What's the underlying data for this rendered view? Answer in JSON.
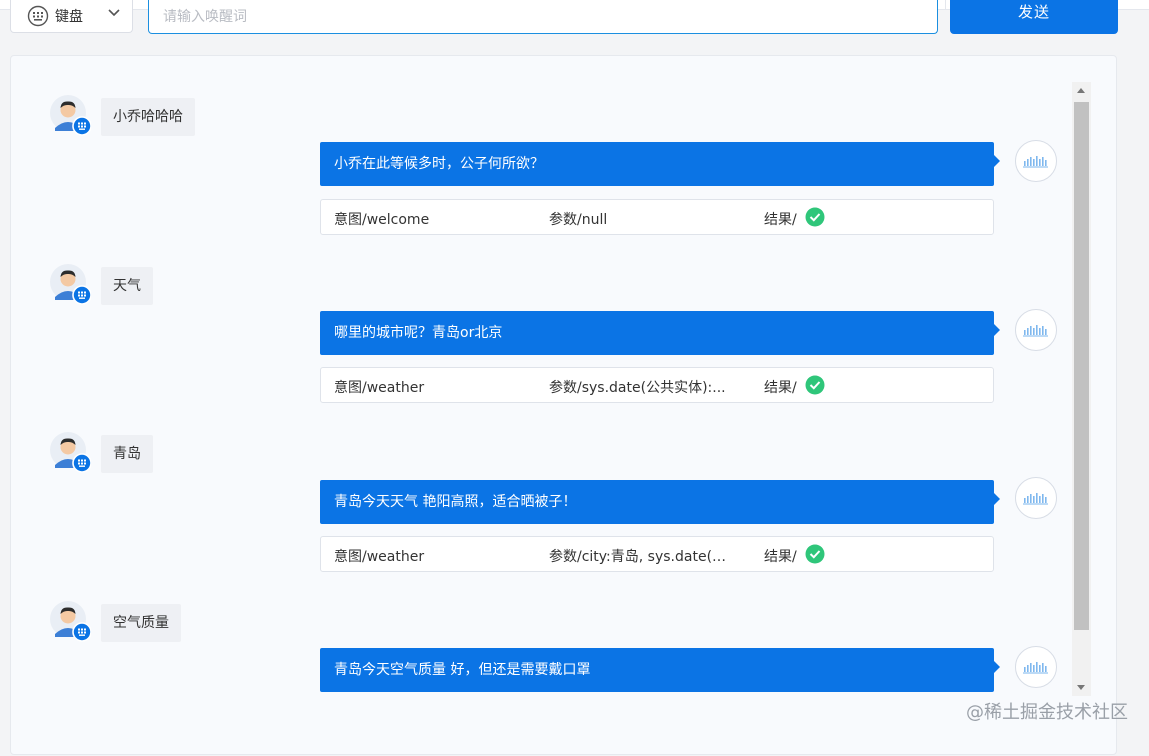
{
  "header": {
    "mode_select": {
      "icon": "keyboard-icon",
      "label": "键盘",
      "chevron": "chevron-down-icon"
    },
    "input": {
      "value": "",
      "placeholder": "请输入唤醒词"
    },
    "send_label": "发送"
  },
  "colors": {
    "accent": "#0b74e5",
    "bot_bubble": "#0b74e5",
    "user_bubble": "#eef0f4",
    "success": "#2fc67a"
  },
  "conversation": [
    {
      "user_text": "小乔哈哈哈",
      "bot_text": "小乔在此等候多时，公子何所欲？",
      "result": {
        "intent": "意图/welcome",
        "params": "参数/null",
        "result_label": "结果/",
        "status": "success"
      }
    },
    {
      "user_text": "天气",
      "bot_text": "哪里的城市呢？青岛or北京",
      "result": {
        "intent": "意图/weather",
        "params": "参数/sys.date(公共实体):...",
        "result_label": "结果/",
        "status": "success"
      }
    },
    {
      "user_text": "青岛",
      "bot_text": "青岛今天天气 艳阳高照，适合晒被子！",
      "result": {
        "intent": "意图/weather",
        "params": "参数/city:青岛, sys.date(公...",
        "result_label": "结果/",
        "status": "success"
      }
    },
    {
      "user_text": "空气质量",
      "bot_text": "青岛今天空气质量 好，但还是需要戴口罩"
    }
  ],
  "icons": {
    "user_avatar": "user-avatar-icon",
    "bot_avatar": "voice-wave-icon",
    "check": "check-circle-icon"
  },
  "watermark": "@稀土掘金技术社区"
}
